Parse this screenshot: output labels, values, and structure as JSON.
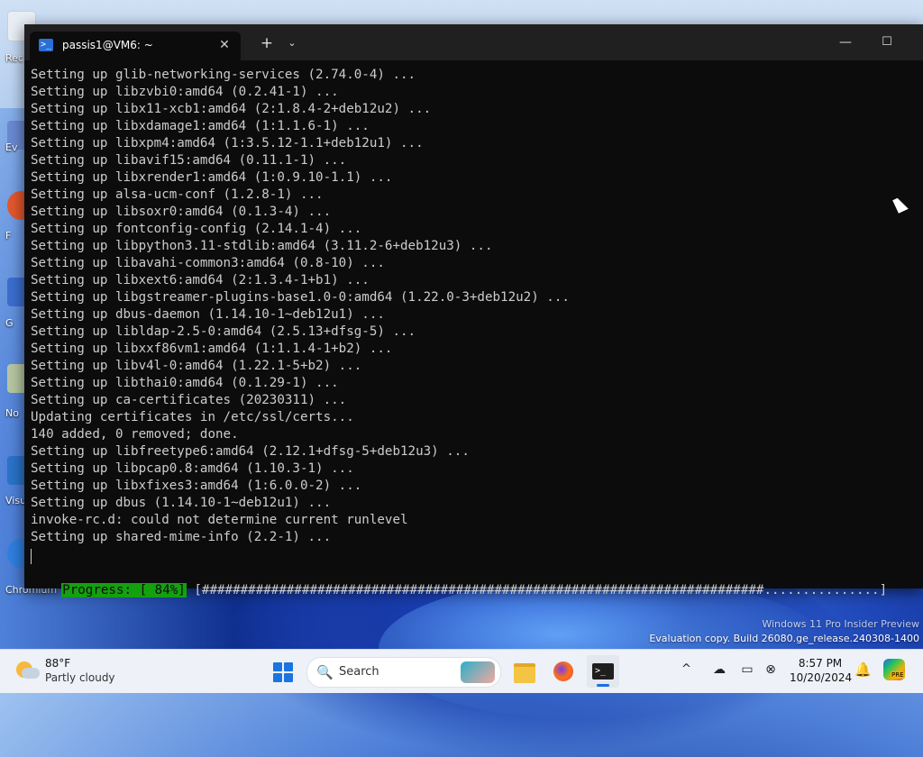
{
  "desktop": {
    "icon_labels": [
      "Rec",
      "Ev",
      "F",
      "G",
      "No",
      "Visu",
      "Chromium"
    ]
  },
  "watermark": {
    "line1": "Windows 11 Pro Insider Preview",
    "line2": "Evaluation copy. Build 26080.ge_release.240308-1400"
  },
  "terminal": {
    "tab_title": "passis1@VM6: ~",
    "tab_icon": ">_",
    "close_glyph": "✕",
    "new_tab_glyph": "+",
    "dropdown_glyph": "⌄",
    "minimize_glyph": "—",
    "maximize_glyph": "☐",
    "lines": [
      "Setting up glib-networking-services (2.74.0-4) ...",
      "Setting up libzvbi0:amd64 (0.2.41-1) ...",
      "Setting up libx11-xcb1:amd64 (2:1.8.4-2+deb12u2) ...",
      "Setting up libxdamage1:amd64 (1:1.1.6-1) ...",
      "Setting up libxpm4:amd64 (1:3.5.12-1.1+deb12u1) ...",
      "Setting up libavif15:amd64 (0.11.1-1) ...",
      "Setting up libxrender1:amd64 (1:0.9.10-1.1) ...",
      "Setting up alsa-ucm-conf (1.2.8-1) ...",
      "Setting up libsoxr0:amd64 (0.1.3-4) ...",
      "Setting up fontconfig-config (2.14.1-4) ...",
      "Setting up libpython3.11-stdlib:amd64 (3.11.2-6+deb12u3) ...",
      "Setting up libavahi-common3:amd64 (0.8-10) ...",
      "Setting up libxext6:amd64 (2:1.3.4-1+b1) ...",
      "Setting up libgstreamer-plugins-base1.0-0:amd64 (1.22.0-3+deb12u2) ...",
      "Setting up dbus-daemon (1.14.10-1~deb12u1) ...",
      "Setting up libldap-2.5-0:amd64 (2.5.13+dfsg-5) ...",
      "Setting up libxxf86vm1:amd64 (1:1.1.4-1+b2) ...",
      "Setting up libv4l-0:amd64 (1.22.1-5+b2) ...",
      "Setting up libthai0:amd64 (0.1.29-1) ...",
      "Setting up ca-certificates (20230311) ...",
      "Updating certificates in /etc/ssl/certs...",
      "140 added, 0 removed; done.",
      "Setting up libfreetype6:amd64 (2.12.1+dfsg-5+deb12u3) ...",
      "Setting up libpcap0.8:amd64 (1.10.3-1) ...",
      "Setting up libxfixes3:amd64 (1:6.0.0-2) ...",
      "Setting up dbus (1.14.10-1~deb12u1) ...",
      "invoke-rc.d: could not determine current runlevel",
      "Setting up shared-mime-info (2.2-1) ..."
    ],
    "progress_label": "Progress: [ 84%]",
    "progress_percent": 84,
    "progress_bar": " [#########################################################################...............]"
  },
  "taskbar": {
    "weather_temp": "88°F",
    "weather_desc": "Partly cloudy",
    "search_placeholder": "Search",
    "search_glyph": "🔍",
    "clock_time": "8:57 PM",
    "clock_date": "10/20/2024",
    "tray_chevron": "^",
    "copilot_badge": "PRE",
    "icons": [
      "weather-icon",
      "windows-start-icon",
      "search-icon",
      "file-explorer-icon",
      "firefox-icon",
      "terminal-icon",
      "show-hidden-icons-icon",
      "network-icon",
      "display-icon",
      "volume-muted-icon",
      "notification-bell-icon",
      "copilot-icon"
    ]
  },
  "colors": {
    "terminal_bg": "#0c0c0c",
    "terminal_text": "#cccccc",
    "progress_green": "#13a10e",
    "taskbar_bg": "#eef1f7",
    "accent": "#1a75e0"
  }
}
